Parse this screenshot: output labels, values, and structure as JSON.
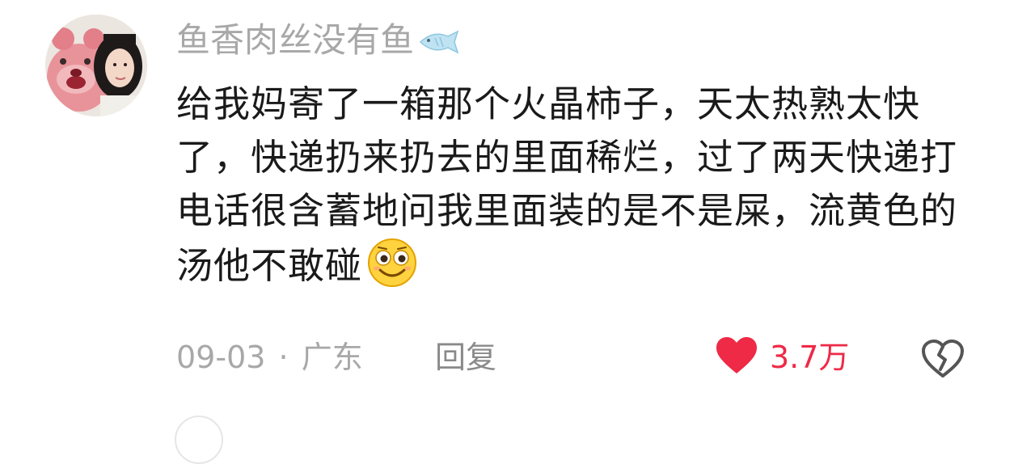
{
  "comment": {
    "username": "鱼香肉丝没有鱼",
    "badge_icon": "fish-icon",
    "text": "给我妈寄了一箱那个火晶柿子，天太热熟太快了，快递扔来扔去的里面稀烂，过了两天快递打电话很含蓄地问我里面装的是不是屎，流黄色的汤他不敢碰",
    "emoji_icon": "smiling-face-emoji-icon",
    "date": "09-03",
    "separator": "·",
    "location": "广东",
    "reply_label": "回复",
    "like_count": "3.7万",
    "like_icon": "heart-icon",
    "dislike_icon": "broken-heart-icon"
  },
  "colors": {
    "username": "#a8a8a8",
    "text": "#1a1a1a",
    "meta": "#a8a8a8",
    "like": "#ee2a47"
  }
}
